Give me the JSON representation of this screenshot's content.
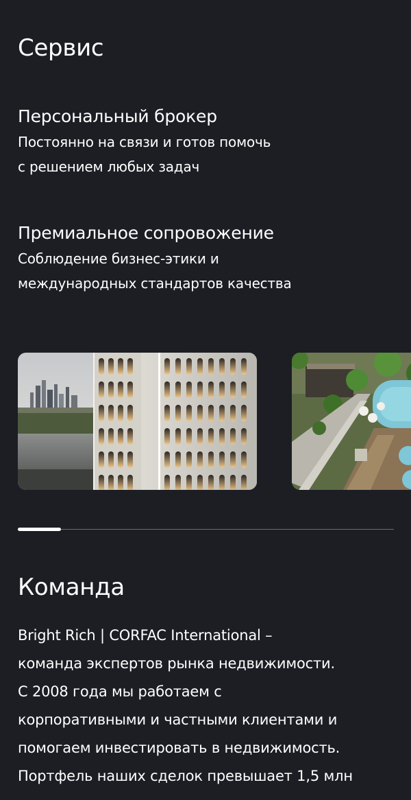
{
  "service": {
    "title": "Сервис",
    "items": [
      {
        "title": "Персональный брокер",
        "desc_line1": "Постоянно на связи и готов помочь",
        "desc_line2": "с решением любых задач"
      },
      {
        "title": "Премиальное сопровожение",
        "desc_line1": "Соблюдение бизнес-этики и",
        "desc_line2": "международных стандартов качества"
      }
    ]
  },
  "carousel": {
    "slides": [
      {
        "image": "building-city-photo"
      },
      {
        "image": "rooftop-pool-photo"
      }
    ],
    "progress": 0.115
  },
  "team": {
    "title": "Команда",
    "lines": [
      "Bright Rich | CORFAC International –",
      "команда экспертов рынка  недвижимости.",
      "С 2008 года мы работаем с",
      "корпоративными и частными клиентами и",
      "помогаем инвестировать в недвижимость.",
      "Портфель наших сделок превышает 1,5 млн"
    ]
  }
}
